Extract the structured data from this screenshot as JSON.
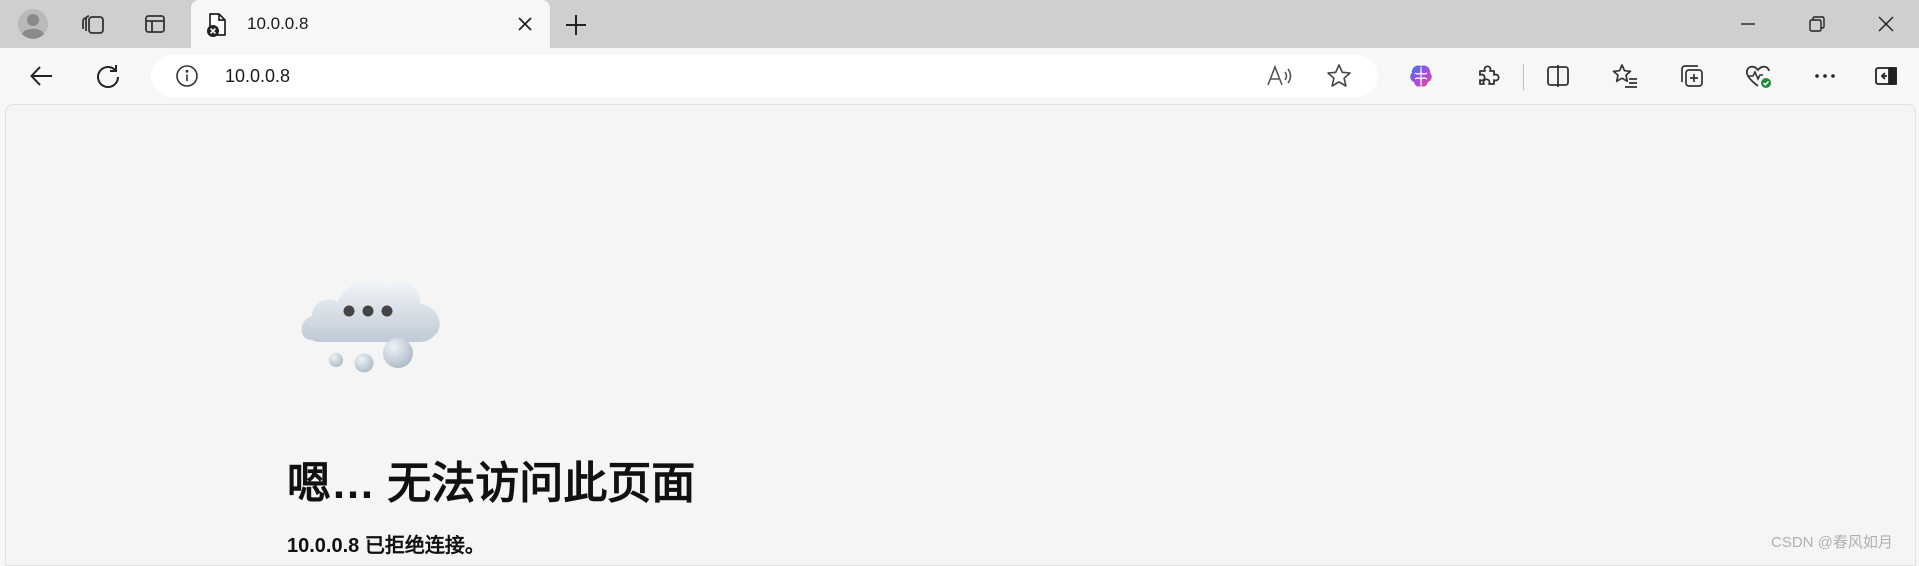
{
  "tab": {
    "title": "10.0.0.8"
  },
  "address_bar": {
    "url": "10.0.0.8"
  },
  "error_page": {
    "heading": "嗯… 无法访问此页面",
    "message": "10.0.0.8 已拒绝连接。"
  },
  "watermark": "CSDN @春风如月",
  "icons": {
    "profile": "profile-avatar-icon",
    "workspaces": "workspaces-icon",
    "tab_actions": "vertical-tabs-icon",
    "tab_favicon": "page-error-icon",
    "close_tab": "close-icon",
    "new_tab": "plus-icon",
    "back": "back-arrow-icon",
    "refresh": "refresh-icon",
    "site_info": "info-icon",
    "read_aloud": "read-aloud-icon",
    "favorite": "star-icon",
    "copilot": "copilot-icon",
    "extensions": "puzzle-icon",
    "split_screen": "split-screen-icon",
    "favorites": "favorites-list-icon",
    "collections": "collections-icon",
    "browser_essentials": "heart-pulse-icon",
    "more": "more-icon",
    "sidebar": "sidebar-toggle-icon"
  },
  "colors": {
    "tabstrip": "#cfcfcf",
    "page_background": "#f5f5f5",
    "text": "#111111",
    "watermark": "#b0b0b0"
  }
}
